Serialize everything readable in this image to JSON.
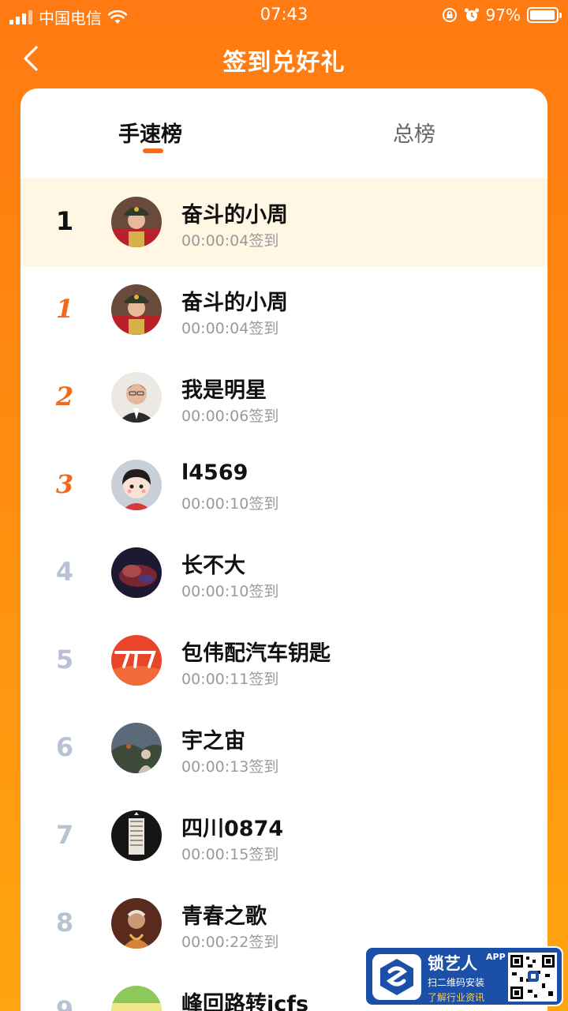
{
  "status_bar": {
    "carrier": "中国电信",
    "time": "07:43",
    "battery": "97%"
  },
  "nav": {
    "title": "签到兑好礼"
  },
  "tabs": [
    {
      "label": "手速榜",
      "active": true
    },
    {
      "label": "总榜",
      "active": false
    }
  ],
  "my_entry": {
    "rank": "1",
    "name": "奋斗的小周",
    "time": "00:00:04签到"
  },
  "leaderboard": [
    {
      "rank": "1",
      "name": "奋斗的小周",
      "time": "00:00:04签到"
    },
    {
      "rank": "2",
      "name": "我是明星",
      "time": "00:00:06签到"
    },
    {
      "rank": "3",
      "name": "l4569",
      "time": "00:00:10签到"
    },
    {
      "rank": "4",
      "name": "长不大",
      "time": "00:00:10签到"
    },
    {
      "rank": "5",
      "name": "包伟配汽车钥匙",
      "time": "00:00:11签到"
    },
    {
      "rank": "6",
      "name": "宇之宙",
      "time": "00:00:13签到"
    },
    {
      "rank": "7",
      "name": "四川0874",
      "time": "00:00:15签到"
    },
    {
      "rank": "8",
      "name": "青春之歌",
      "time": "00:00:22签到"
    },
    {
      "rank": "9",
      "name": "峰回路转jcfs",
      "time": ""
    }
  ],
  "watermark": {
    "title": "锁艺人",
    "app": "APP",
    "line1": "扫二维码安装",
    "line2": "了解行业资讯"
  },
  "colors": {
    "accent": "#ff6a1a",
    "header_bg": "#ff7a12",
    "highlight_row": "#fff7e3",
    "medal_rank": "#ef6a1a",
    "plain_rank": "#b9c2d3"
  }
}
